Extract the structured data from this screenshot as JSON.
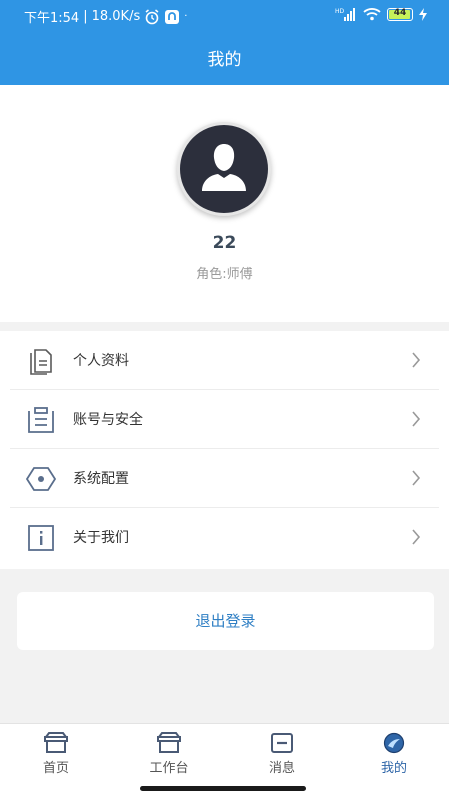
{
  "status_bar": {
    "time": "下午1:54",
    "speed": "18.0K/s",
    "battery": "44"
  },
  "header": {
    "title": "我的"
  },
  "profile": {
    "username": "22",
    "role": "角色:师傅"
  },
  "menu": [
    {
      "label": "个人资料",
      "icon": "document-icon"
    },
    {
      "label": "账号与安全",
      "icon": "list-icon"
    },
    {
      "label": "系统配置",
      "icon": "hexagon-settings-icon"
    },
    {
      "label": "关于我们",
      "icon": "info-icon"
    }
  ],
  "logout_label": "退出登录",
  "tabs": [
    {
      "label": "首页",
      "icon": "home-icon",
      "active": false
    },
    {
      "label": "工作台",
      "icon": "workbench-icon",
      "active": false
    },
    {
      "label": "消息",
      "icon": "message-icon",
      "active": false
    },
    {
      "label": "我的",
      "icon": "profile-icon",
      "active": true
    }
  ],
  "colors": {
    "primary": "#2f95e4",
    "active_tab": "#2f66a8",
    "logout_text": "#2f7fc4"
  }
}
